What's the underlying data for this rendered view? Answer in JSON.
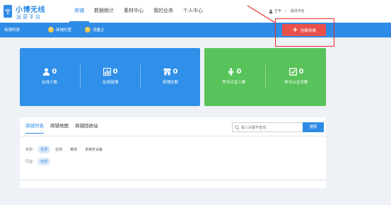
{
  "header": {
    "logo_title": "小博无线",
    "logo_subtitle": "运营平台",
    "nav": [
      {
        "label": "商铺",
        "active": true
      },
      {
        "label": "数据统计",
        "active": false
      },
      {
        "label": "素材中心",
        "active": false
      },
      {
        "label": "我的业务",
        "active": false
      },
      {
        "label": "个人中心",
        "active": false
      }
    ],
    "user_name": "王丰",
    "logout": "退出平台"
  },
  "subbar": {
    "items": [
      {
        "label": "商铺列表"
      },
      {
        "label": "商铺托管",
        "badge": "0"
      },
      {
        "label": "流量主",
        "badge": "0"
      }
    ],
    "create_button": "创建商铺"
  },
  "stats_blue": [
    {
      "icon": "user-icon",
      "value": "0",
      "label": "在线人数"
    },
    {
      "icon": "bar-chart-icon",
      "value": "0",
      "label": "在线商铺"
    },
    {
      "icon": "shop-icon",
      "value": "0",
      "label": "商铺总数"
    }
  ],
  "stats_green": [
    {
      "icon": "person-group-icon",
      "value": "0",
      "label": "昨日认证人数"
    },
    {
      "icon": "checkbox-icon",
      "value": "0",
      "label": "昨日认证总数"
    }
  ],
  "panel": {
    "tabs": [
      {
        "label": "商铺列表",
        "active": true
      },
      {
        "label": "商铺地图",
        "active": false
      },
      {
        "label": "商铺回收站",
        "active": false
      }
    ],
    "search_placeholder": "输入关键字查询",
    "search_button": "搜索",
    "status_filter": {
      "label": "状态：",
      "options": [
        {
          "label": "全部",
          "active": true
        },
        {
          "label": "在线",
          "active": false
        },
        {
          "label": "离线",
          "active": false
        },
        {
          "label": "未绑定设备",
          "active": false
        }
      ]
    },
    "industry_filter": {
      "label": "行业：",
      "options": [
        {
          "label": "全部",
          "active": true
        }
      ]
    }
  },
  "colors": {
    "primary": "#2e8be6",
    "create": "#e8504a",
    "stat_blue": "#2f8fe9",
    "stat_green": "#57c35a",
    "highlight": "#e6302b"
  }
}
